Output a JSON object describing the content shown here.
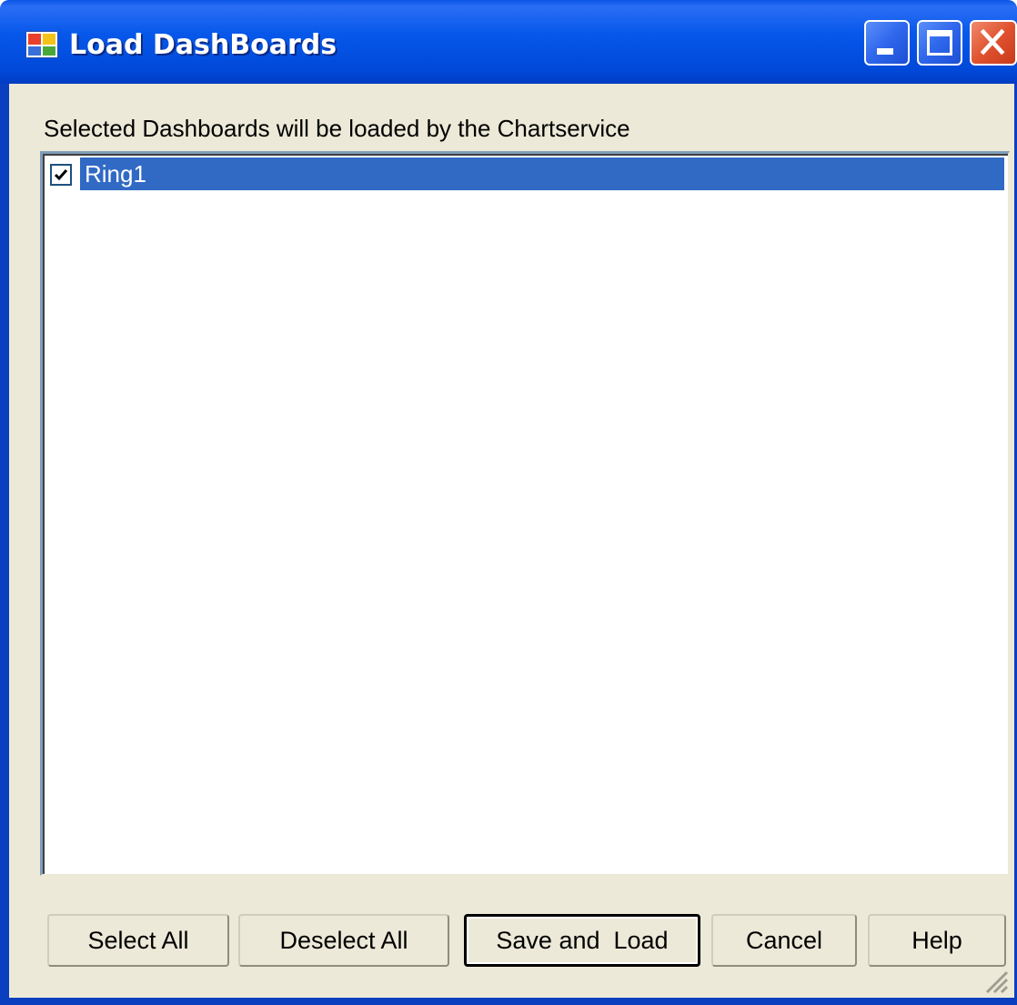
{
  "window": {
    "title": "Load DashBoards",
    "title_bar_color": "#0a55e6",
    "icon": "app-window-icon",
    "controls": [
      "minimize-icon",
      "maximize-icon",
      "close-icon"
    ]
  },
  "content": {
    "instruction": "Selected Dashboards will be loaded by the Chartservice",
    "list": {
      "items": [
        {
          "label": "Ring1",
          "checked": true,
          "selected": true
        }
      ],
      "selection_color": "#316ac5"
    }
  },
  "buttons": {
    "select_all": "Select All",
    "deselect_all": "Deselect All",
    "save_and_load": "Save and  Load",
    "cancel": "Cancel",
    "help": "Help"
  }
}
